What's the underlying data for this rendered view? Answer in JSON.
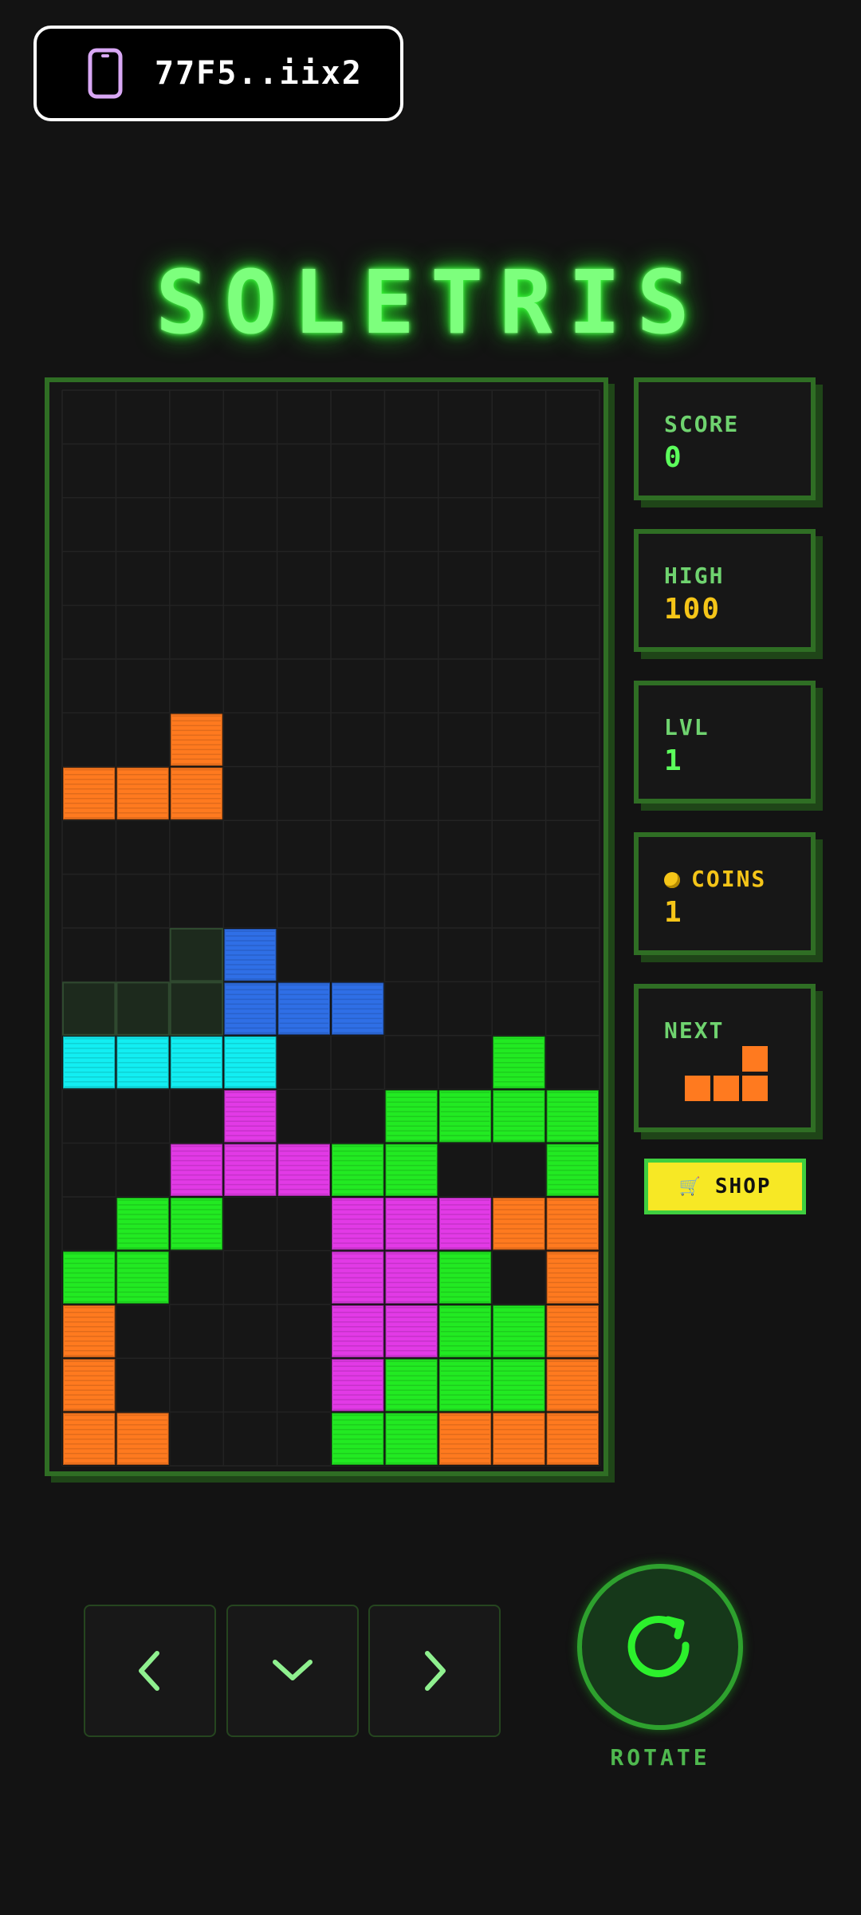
{
  "wallet": {
    "address": "77F5..iix2",
    "icon": "phone-icon"
  },
  "title": "SOLETRIS",
  "stats": {
    "score": {
      "label": "SCORE",
      "value": "0"
    },
    "high": {
      "label": "HIGH",
      "value": "100"
    },
    "level": {
      "label": "LVL",
      "value": "1"
    },
    "coins": {
      "label": "COINS",
      "value": "1",
      "icon": "coin-icon"
    },
    "next": {
      "label": "NEXT",
      "piece": "L"
    }
  },
  "shop": {
    "label": "SHOP",
    "icon": "cart-icon"
  },
  "controls": {
    "left_icon": "chevron-left-icon",
    "down_icon": "chevron-down-icon",
    "right_icon": "chevron-right-icon",
    "rotate_label": "ROTATE",
    "rotate_icon": "rotate-icon"
  },
  "colors": {
    "orange": "#ff7a1f",
    "blue": "#2f6fe6",
    "cyan": "#12eef2",
    "magenta": "#e23ae6",
    "green": "#22ea22",
    "ghost": "#1d2a1d",
    "board_border": "#2f6e24",
    "title_glow": "#2fff2f"
  },
  "board": {
    "columns": 10,
    "rows": 20,
    "cells": [
      [
        2,
        6,
        "orange"
      ],
      [
        0,
        7,
        "orange"
      ],
      [
        1,
        7,
        "orange"
      ],
      [
        2,
        7,
        "orange"
      ],
      [
        2,
        10,
        "ghost"
      ],
      [
        3,
        10,
        "blue"
      ],
      [
        0,
        11,
        "ghost"
      ],
      [
        1,
        11,
        "ghost"
      ],
      [
        2,
        11,
        "ghost"
      ],
      [
        3,
        11,
        "blue"
      ],
      [
        4,
        11,
        "blue"
      ],
      [
        5,
        11,
        "blue"
      ],
      [
        0,
        12,
        "cyan"
      ],
      [
        1,
        12,
        "cyan"
      ],
      [
        2,
        12,
        "cyan"
      ],
      [
        3,
        12,
        "cyan"
      ],
      [
        8,
        12,
        "green"
      ],
      [
        3,
        13,
        "magenta"
      ],
      [
        6,
        13,
        "green"
      ],
      [
        7,
        13,
        "green"
      ],
      [
        8,
        13,
        "green"
      ],
      [
        9,
        13,
        "green"
      ],
      [
        2,
        14,
        "magenta"
      ],
      [
        3,
        14,
        "magenta"
      ],
      [
        4,
        14,
        "magenta"
      ],
      [
        5,
        14,
        "green"
      ],
      [
        6,
        14,
        "green"
      ],
      [
        9,
        14,
        "green"
      ],
      [
        1,
        15,
        "green"
      ],
      [
        2,
        15,
        "green"
      ],
      [
        5,
        15,
        "magenta"
      ],
      [
        6,
        15,
        "magenta"
      ],
      [
        7,
        15,
        "magenta"
      ],
      [
        8,
        15,
        "orange"
      ],
      [
        9,
        15,
        "orange"
      ],
      [
        0,
        16,
        "green"
      ],
      [
        1,
        16,
        "green"
      ],
      [
        5,
        16,
        "magenta"
      ],
      [
        6,
        16,
        "magenta"
      ],
      [
        7,
        16,
        "green"
      ],
      [
        9,
        16,
        "orange"
      ],
      [
        0,
        17,
        "orange"
      ],
      [
        5,
        17,
        "magenta"
      ],
      [
        6,
        17,
        "magenta"
      ],
      [
        7,
        17,
        "green"
      ],
      [
        8,
        17,
        "green"
      ],
      [
        9,
        17,
        "orange"
      ],
      [
        0,
        18,
        "orange"
      ],
      [
        5,
        18,
        "magenta"
      ],
      [
        6,
        18,
        "green"
      ],
      [
        7,
        18,
        "green"
      ],
      [
        8,
        18,
        "green"
      ],
      [
        9,
        18,
        "orange"
      ],
      [
        0,
        19,
        "orange"
      ],
      [
        1,
        19,
        "orange"
      ],
      [
        5,
        19,
        "green"
      ],
      [
        6,
        19,
        "green"
      ],
      [
        7,
        19,
        "orange"
      ],
      [
        8,
        19,
        "orange"
      ],
      [
        9,
        19,
        "orange"
      ]
    ]
  }
}
